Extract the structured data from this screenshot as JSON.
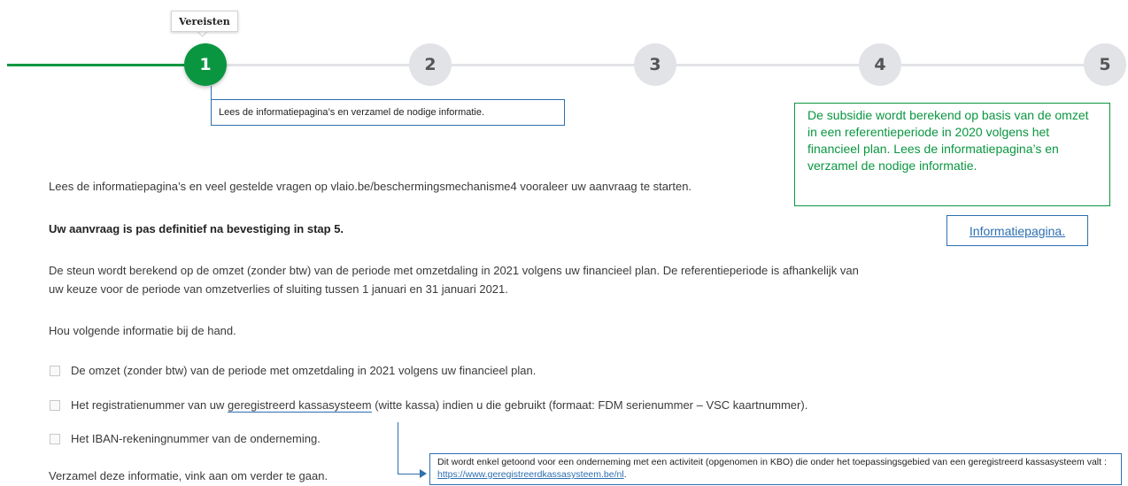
{
  "stepper": {
    "tooltip": "Vereisten",
    "steps": [
      "1",
      "2",
      "3",
      "4",
      "5"
    ],
    "active_step": 1,
    "colors": {
      "active": "#0a9640",
      "inactive": "#e1e3e6"
    }
  },
  "annotations": {
    "step1_note": "Lees de informatiepagina’s en verzamel de nodige informatie.",
    "subsidie_note": "De subsidie wordt berekend op basis van de omzet in een referentieperiode in 2020 volgens het financieel plan. Lees de informatiepagina’s en verzamel de nodige informatie.",
    "info_link": "Informatiepagina.",
    "kassa_note_text": "Dit wordt enkel getoond voor een onderneming met een activiteit (opgenomen in KBO) die onder het toepassingsgebied van een geregistreerd kassasysteem valt : ",
    "kassa_note_link": "https://www.geregistreerdkassasysteem.be/nl",
    "kassa_note_end": "."
  },
  "content": {
    "intro": "Lees de informatiepagina’s en veel gestelde vragen op vlaio.be/beschermingsmechanisme4 vooraleer uw aanvraag te starten.",
    "definitief": "Uw aanvraag is pas definitief na bevestiging in stap 5.",
    "steun_line1": "De steun wordt berekend op de omzet (zonder btw) van de periode met omzetdaling in 2021 volgens uw financieel plan. De referentieperiode is afhankelijk van",
    "steun_line2": "uw keuze voor de periode van omzetverlies of sluiting tussen 1 januari en 31 januari 2021.",
    "hou_info": "Hou volgende informatie bij de hand.",
    "checklist": [
      {
        "label": "De omzet (zonder btw) van de periode met omzetdaling in 2021 volgens uw financieel plan.",
        "checked": false
      },
      {
        "label_pre": "Het registratienummer van uw ",
        "label_ul": "geregistreerd kassasysteem",
        "label_post": " (witte kassa) indien u die gebruikt (formaat: FDM serienummer – VSC kaartnummer).",
        "checked": false
      },
      {
        "label": "Het IBAN-rekeningnummer van de onderneming.",
        "checked": false
      }
    ],
    "verzamel": "Verzamel deze informatie, vink aan om verder te gaan."
  }
}
